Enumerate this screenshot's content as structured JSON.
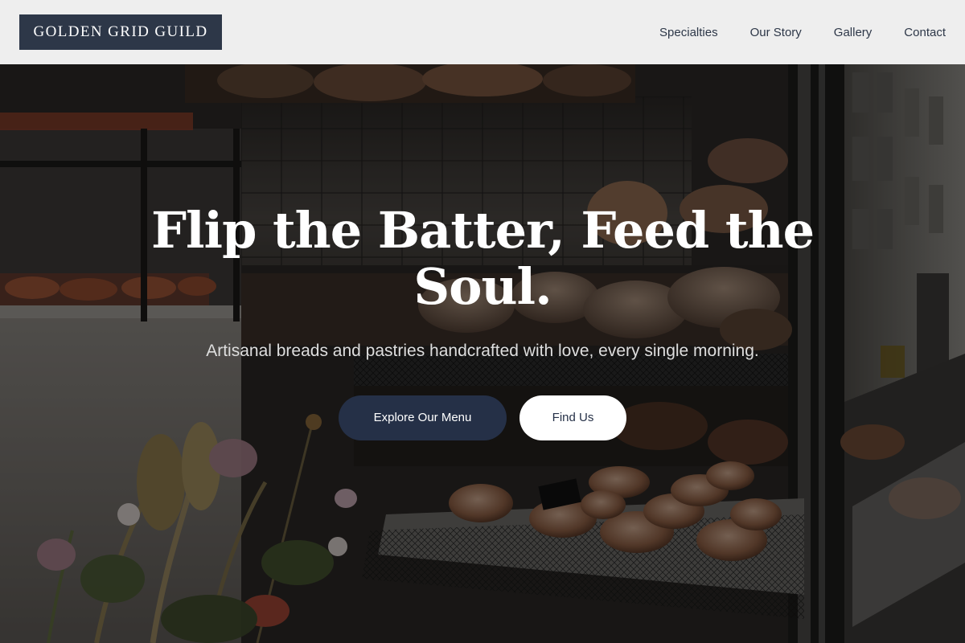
{
  "header": {
    "logo_text": "GOLDEN GRID GUILD",
    "nav": [
      {
        "label": "Specialties"
      },
      {
        "label": "Our Story"
      },
      {
        "label": "Gallery"
      },
      {
        "label": "Contact"
      }
    ]
  },
  "hero": {
    "title": "Flip the Batter, Feed the Soul.",
    "subtitle": "Artisanal breads and pastries handcrafted with love, every single morning.",
    "primary_button": "Explore Our Menu",
    "secondary_button": "Find Us"
  },
  "colors": {
    "header_bg": "#eeeeee",
    "brand_dark": "#2d3748",
    "button_primary_bg": "#253047",
    "button_secondary_bg": "#ffffff"
  }
}
